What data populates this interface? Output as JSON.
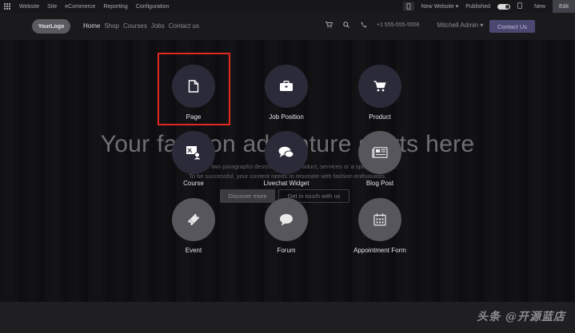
{
  "adminbar": {
    "app_name": "Website",
    "menu": [
      "Site",
      "eCommerce",
      "Reporting",
      "Configuration"
    ],
    "new_website": "New Website",
    "published": "Published",
    "new": "New",
    "edit": "Edit"
  },
  "navbar": {
    "logo": "YourLogo",
    "menu": [
      "Home",
      "Shop",
      "Courses",
      "Jobs",
      "Contact us"
    ],
    "phone": "+1 555-555-5556",
    "user": "Mitchell Admin",
    "contact_button": "Contact Us"
  },
  "hero": {
    "title": "Your fashion adventure starts here",
    "subtitle_1": "Write one or two paragraphs describing your product, services or a specific feature.",
    "subtitle_2": "To be successful, your content needs to resonate with fashion enthusiasts.",
    "primary_button": "Discover more",
    "secondary_button": "Get in touch with us"
  },
  "options": [
    {
      "label": "Page",
      "icon": "page-icon"
    },
    {
      "label": "Job Position",
      "icon": "briefcase-icon"
    },
    {
      "label": "Product",
      "icon": "cart-icon"
    },
    {
      "label": "Course",
      "icon": "course-icon"
    },
    {
      "label": "Livechat Widget",
      "icon": "chat-icon"
    },
    {
      "label": "Blog Post",
      "icon": "newspaper-icon"
    },
    {
      "label": "Event",
      "icon": "ticket-icon"
    },
    {
      "label": "Forum",
      "icon": "speech-bubble-icon"
    },
    {
      "label": "Appointment Form",
      "icon": "calendar-icon"
    }
  ],
  "watermark": "头条 @开源蓝店",
  "colors": {
    "highlight": "#e2281f",
    "accent": "#4a4770"
  }
}
